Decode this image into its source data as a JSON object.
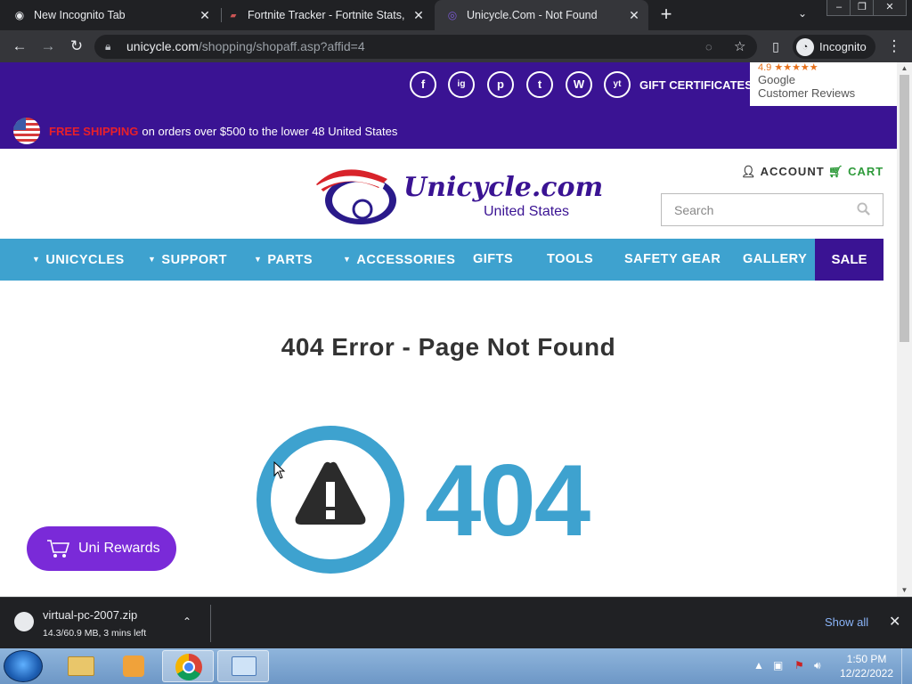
{
  "browser": {
    "tabs": [
      {
        "title": "New Incognito Tab",
        "active": false
      },
      {
        "title": "Fortnite Tracker - Fortnite Stats, L",
        "active": false
      },
      {
        "title": "Unicycle.Com - Not Found",
        "active": true
      }
    ],
    "new_tab": "+",
    "url_host": "unicycle.com",
    "url_path": "/shopping/shopaff.asp?affid=4",
    "incognito_label": "Incognito"
  },
  "site": {
    "social": [
      "f",
      "ig",
      "p",
      "t",
      "W",
      "yt"
    ],
    "gift_certificates": "GIFT CERTIFICATES",
    "reviews": {
      "rating": "4.9 ★★★★★",
      "line1": "Google",
      "line2": "Customer Reviews"
    },
    "shipping": {
      "free": "FREE SHIPPING",
      "rest": "on orders over $500 to the lower 48 United States"
    },
    "logo": {
      "name": "Unicycle.com",
      "country": "United States"
    },
    "account": "ACCOUNT",
    "cart": "CART",
    "search_placeholder": "Search",
    "nav": [
      {
        "label": "UNICYCLES",
        "caret": true
      },
      {
        "label": "SUPPORT",
        "caret": true
      },
      {
        "label": "PARTS",
        "caret": true
      },
      {
        "label": "ACCESSORIES",
        "caret": true
      },
      {
        "label": "GIFTS",
        "caret": false
      },
      {
        "label": "TOOLS",
        "caret": false
      },
      {
        "label": "SAFETY GEAR",
        "caret": false
      },
      {
        "label": "GALLERY",
        "caret": false
      }
    ],
    "sale": "SALE",
    "error_title": "404 Error - Page Not Found",
    "error_code": "404",
    "rewards": "Uni Rewards"
  },
  "download": {
    "filename": "virtual-pc-2007.zip",
    "status": "14.3/60.9 MB, 3 mins left",
    "show_all": "Show all"
  },
  "taskbar": {
    "time": "1:50 PM",
    "date": "12/22/2022"
  },
  "colors": {
    "purple": "#3a1393",
    "blue": "#3ea2cf",
    "rewards": "#7a2ad8",
    "cart_green": "#2e9a3a"
  }
}
